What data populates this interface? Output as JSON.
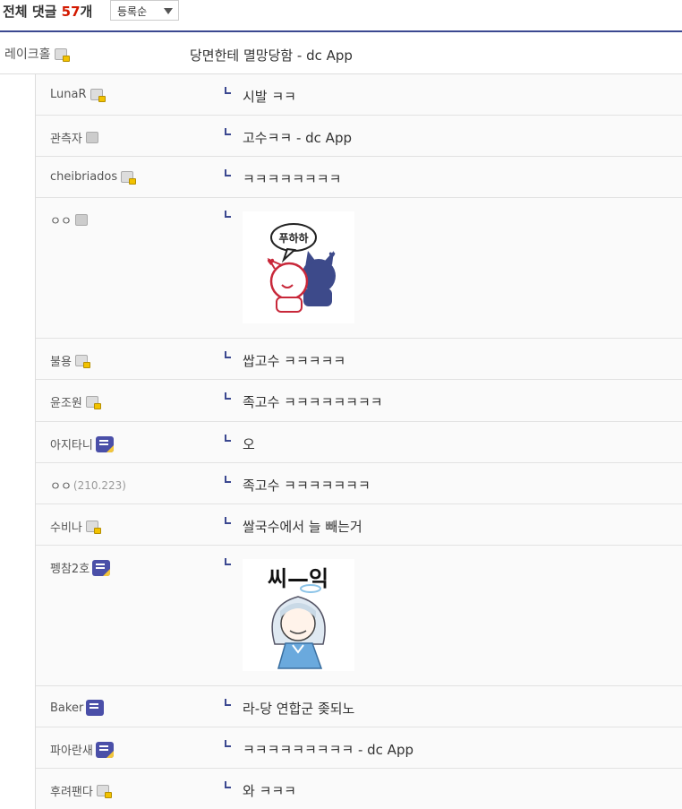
{
  "header": {
    "title_prefix": "전체 댓글 ",
    "count": "57",
    "title_suffix": "개",
    "sort_label": "등록순"
  },
  "main_comment": {
    "nick": "레이크홀",
    "text": "당면한테 멸망당함 - dc App"
  },
  "replies": [
    {
      "nick": "LunaR",
      "text": "시발 ㅋㅋ"
    },
    {
      "nick": "관측자",
      "text": "고수ㅋㅋ - dc App"
    },
    {
      "nick": "cheibriados",
      "text": "ㅋㅋㅋㅋㅋㅋㅋㅋ"
    },
    {
      "nick": "ㅇㅇ",
      "image_caption": "푸하하"
    },
    {
      "nick": "불용",
      "text": "쌉고수 ㅋㅋㅋㅋㅋ"
    },
    {
      "nick": "윤조원",
      "text": "족고수 ㅋㅋㅋㅋㅋㅋㅋㅋ"
    },
    {
      "nick": "아지타니",
      "text": "오"
    },
    {
      "nick": "ㅇㅇ",
      "ip": "(210.223)",
      "text": "족고수 ㅋㅋㅋㅋㅋㅋㅋ"
    },
    {
      "nick": "수비나",
      "text": "쌀국수에서 늘 빼는거"
    },
    {
      "nick": "펭참2호",
      "image_caption": "씨—익"
    },
    {
      "nick": "Baker",
      "text": "라-당 연합군 좆되노"
    },
    {
      "nick": "파아란새",
      "text": "ㅋㅋㅋㅋㅋㅋㅋㅋㅋ - dc App"
    },
    {
      "nick": "후려팬다",
      "text": "와 ㅋㅋㅋ"
    }
  ]
}
